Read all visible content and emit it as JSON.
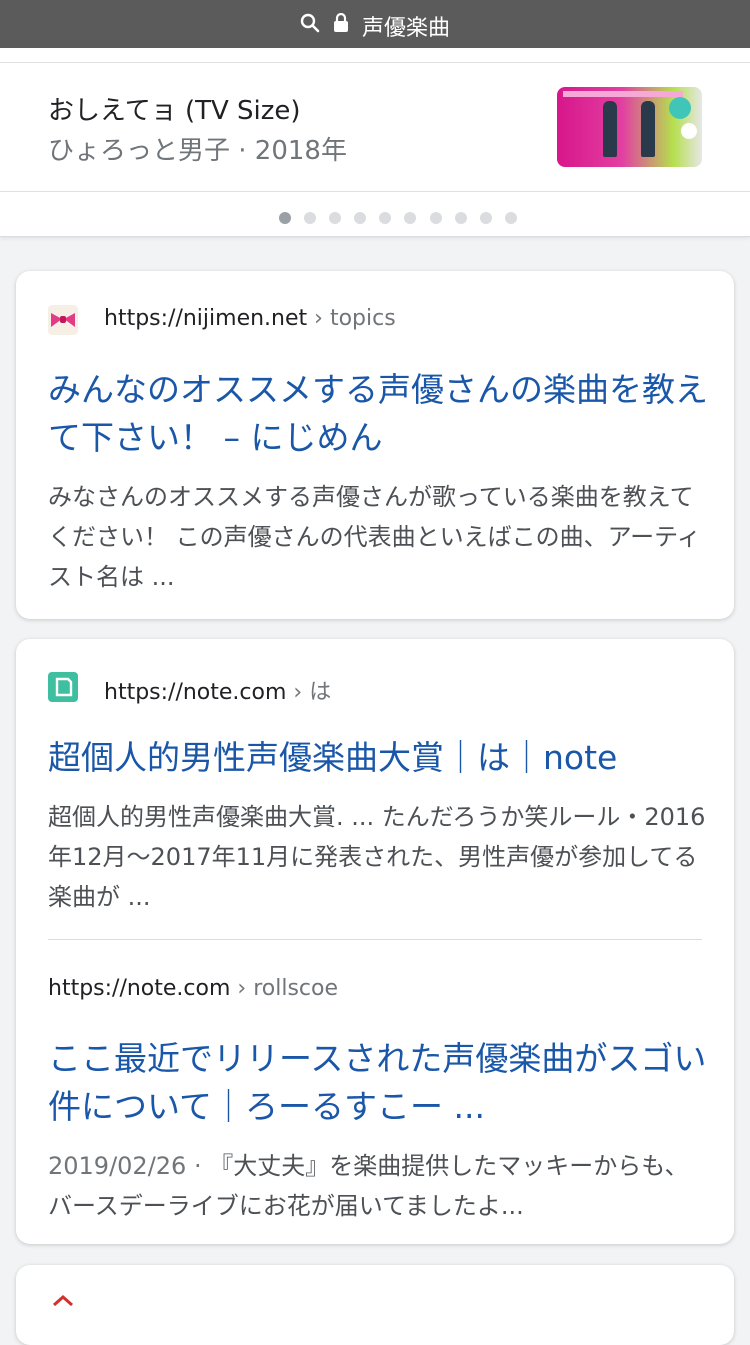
{
  "browser": {
    "search_query": "声優楽曲"
  },
  "carousel": {
    "song_title": "おしえてョ (TV Size)",
    "song_subtitle": "ひょろっと男子 · 2018年",
    "dots_total": 10,
    "dots_active_index": 0
  },
  "results": [
    {
      "favicon": "bow-icon",
      "url": "https://nijimen.net",
      "crumb": "› topics",
      "title": "みんなのオススメする声優さんの楽曲を教えて下さい！ – にじめん",
      "snippet": "みなさんのオススメする声優さんが歌っている楽曲を教えてください！ この声優さんの代表曲といえばこの曲、アーティスト名は ..."
    },
    {
      "favicon": "note-icon",
      "url": "https://note.com",
      "crumb": "› は",
      "title": "超個人的男性声優楽曲大賞｜は｜note",
      "snippet": "超個人的男性声優楽曲大賞. ... たんだろうか笑ルール・2016年12月〜2017年11月に発表された、男性声優が参加してる楽曲が ..."
    },
    {
      "url": "https://note.com",
      "crumb": "› rollscoe",
      "title": "ここ最近でリリースされた声優楽曲がスゴい件について｜ろーるすこー ...",
      "date": "2019/02/26 · ",
      "snippet": "『大丈夫』を楽曲提供したマッキーからも、バースデーライブにお花が届いてましたよ..."
    }
  ],
  "colors": {
    "link": "#1a57a8",
    "topbar": "#5b5b5b"
  }
}
